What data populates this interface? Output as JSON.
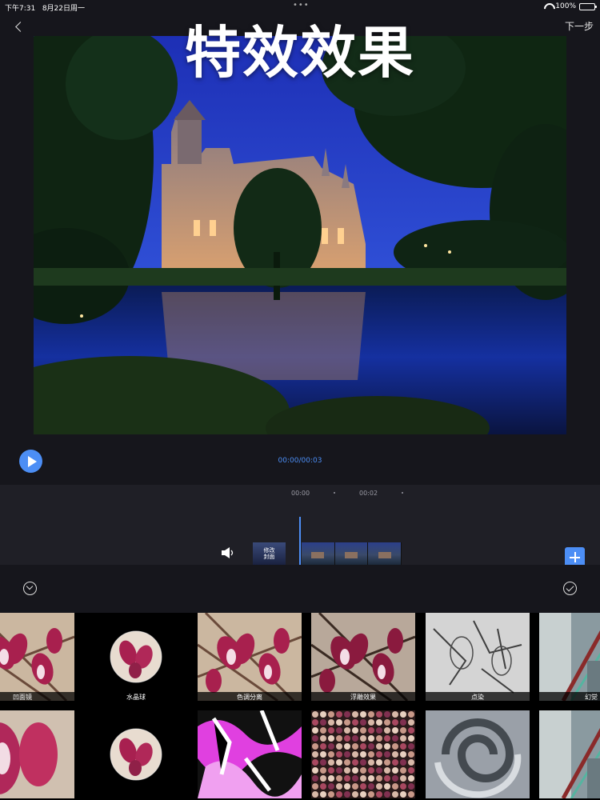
{
  "status_bar": {
    "time": "下午7:31",
    "date": "8月22日周一",
    "battery": "100%"
  },
  "nav": {
    "next_label": "下一步"
  },
  "overlay_title": "特效效果",
  "playback": {
    "time_readout": "00:00/00:03"
  },
  "timeline": {
    "ticks": [
      "00:00",
      "00:02"
    ],
    "cover_label_line1": "修改",
    "cover_label_line2": "封面"
  },
  "effects": [
    {
      "label": "凹面镜",
      "style": "flower"
    },
    {
      "label": "水晶球",
      "style": "crystal"
    },
    {
      "label": "色调分离",
      "style": "flower"
    },
    {
      "label": "浮雕效果",
      "style": "flower-dark"
    },
    {
      "label": "点染",
      "style": "sketch"
    },
    {
      "label": "幻觉",
      "style": "street"
    },
    {
      "label": "",
      "style": "flower-zoom"
    },
    {
      "label": "",
      "style": "crystal"
    },
    {
      "label": "",
      "style": "posterize"
    },
    {
      "label": "",
      "style": "dots"
    },
    {
      "label": "",
      "style": "swirl"
    },
    {
      "label": "",
      "style": "street"
    }
  ],
  "colors": {
    "accent": "#4c8ef5",
    "panel": "#1f1f26",
    "background": "#16161c"
  },
  "icons": [
    "back-icon",
    "play-icon",
    "speaker-icon",
    "add-icon",
    "collapse-icon",
    "confirm-icon",
    "wifi-icon",
    "battery-icon"
  ]
}
